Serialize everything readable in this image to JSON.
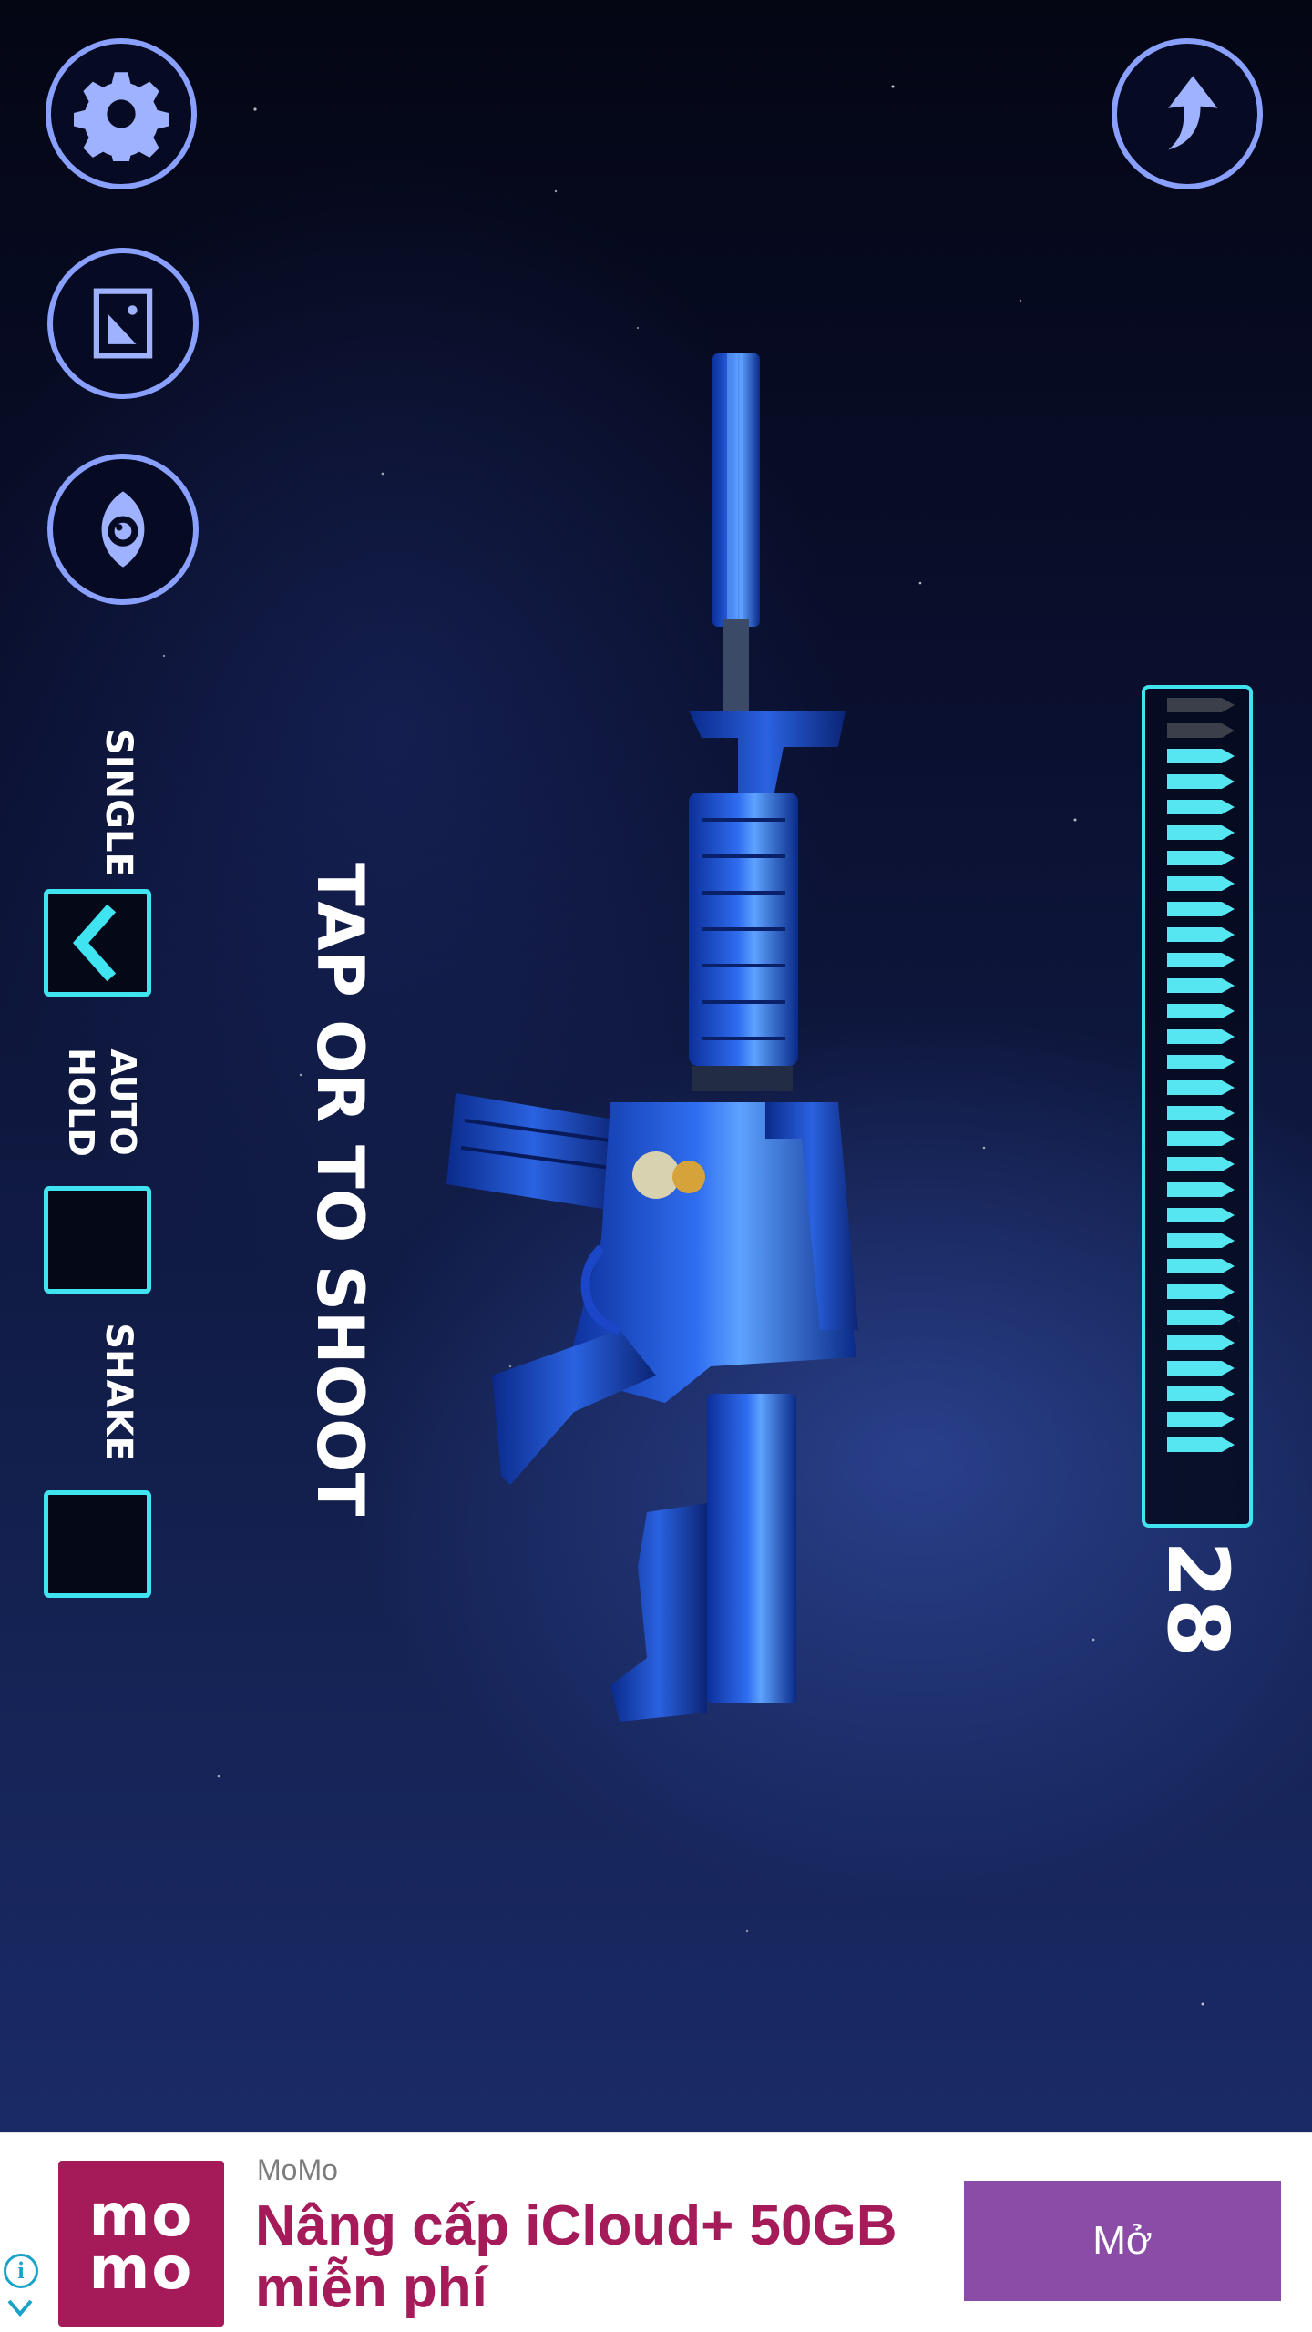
{
  "game": {
    "instruction": "TAP OR TO SHOOT",
    "modes": {
      "single_label": "SINGLE",
      "auto_label_line1": "AUTO",
      "auto_label_line2": "HOLD",
      "shake_label": "SHAKE"
    },
    "selected_mode": "SINGLE",
    "ammo": {
      "count": "28",
      "capacity": 30,
      "loaded": 28
    },
    "buttons": {
      "settings_icon": "gear-icon",
      "gallery_icon": "image-icon",
      "view_icon": "eye-icon",
      "share_icon": "arrow-up-icon"
    }
  },
  "ad": {
    "brand": "MoMo",
    "logo_line1": "mo",
    "logo_line2": "mo",
    "headline": "Nâng cấp iCloud+ 50GB miễn phí",
    "cta": "Mở"
  },
  "colors": {
    "accent_cyan": "#3fe4f0",
    "button_border": "#8aa0ff",
    "ad_brand": "#a51b5a",
    "ad_cta": "#8a4ca6"
  }
}
